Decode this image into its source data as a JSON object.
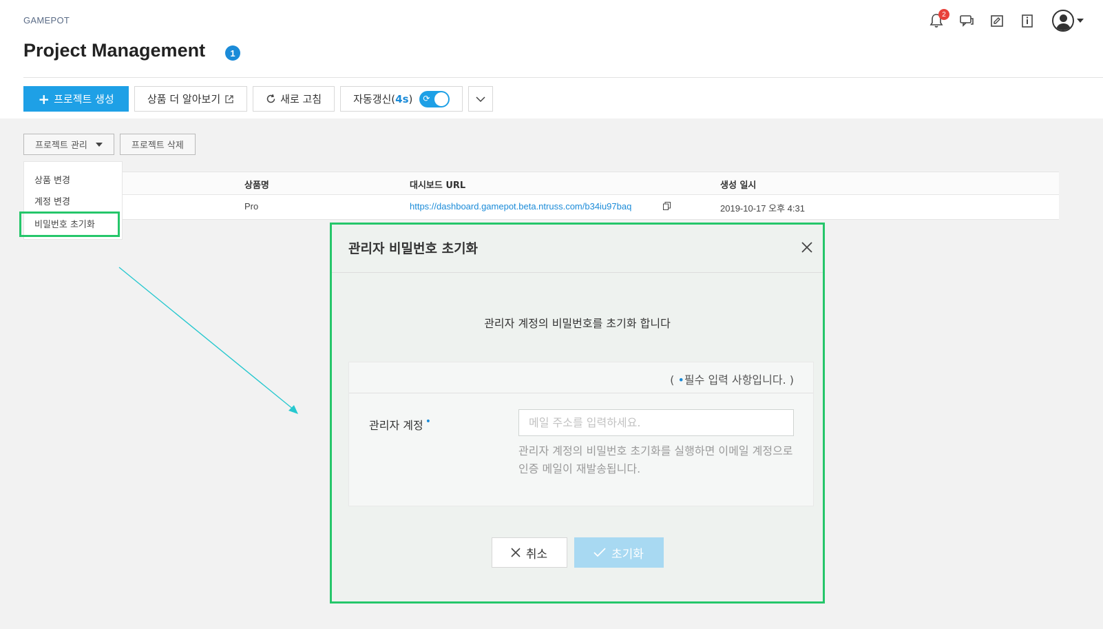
{
  "header": {
    "brand": "GAMEPOT",
    "title": "Project Management",
    "info_badge": "1",
    "notification_count": "2"
  },
  "toolbar": {
    "create_label": "프로젝트 생성",
    "learn_more_label": "상품 더 알아보기",
    "refresh_label": "새로 고침",
    "auto_refresh_label": "자동갱신(",
    "auto_refresh_interval": "4s",
    "auto_refresh_close": ")"
  },
  "sub_toolbar": {
    "manage_label": "프로젝트 관리",
    "delete_label": "프로젝트 삭제"
  },
  "dropdown": {
    "items": [
      {
        "label": "상품 변경"
      },
      {
        "label": "계정 변경"
      },
      {
        "label": "비밀번호 초기화"
      }
    ]
  },
  "table": {
    "headers": [
      "상품명",
      "대시보드 URL",
      "생성 일시"
    ],
    "rows": [
      {
        "product": "Pro",
        "url": "https://dashboard.gamepot.beta.ntruss.com/b34iu97baq",
        "created": "2019-10-17 오후 4:31"
      }
    ]
  },
  "modal": {
    "title": "관리자 비밀번호 초기화",
    "description": "관리자 계정의 비밀번호를 초기화 합니다",
    "required_note_open": "( ",
    "required_note_dot": "•",
    "required_note_text": "필수 입력 사항입니다. )",
    "field_label": "관리자 계정",
    "required_dot": "•",
    "email_placeholder": "메일 주소를 입력하세요.",
    "help_text": "관리자 계정의 비밀번호 초기화를 실행하면 이메일 계정으로 인증 메일이 재발송됩니다.",
    "cancel_label": "취소",
    "reset_label": "초기화"
  },
  "colors": {
    "primary": "#1ea0e6",
    "highlight": "#25c66a",
    "annotation_arrow": "#27c8cf"
  }
}
